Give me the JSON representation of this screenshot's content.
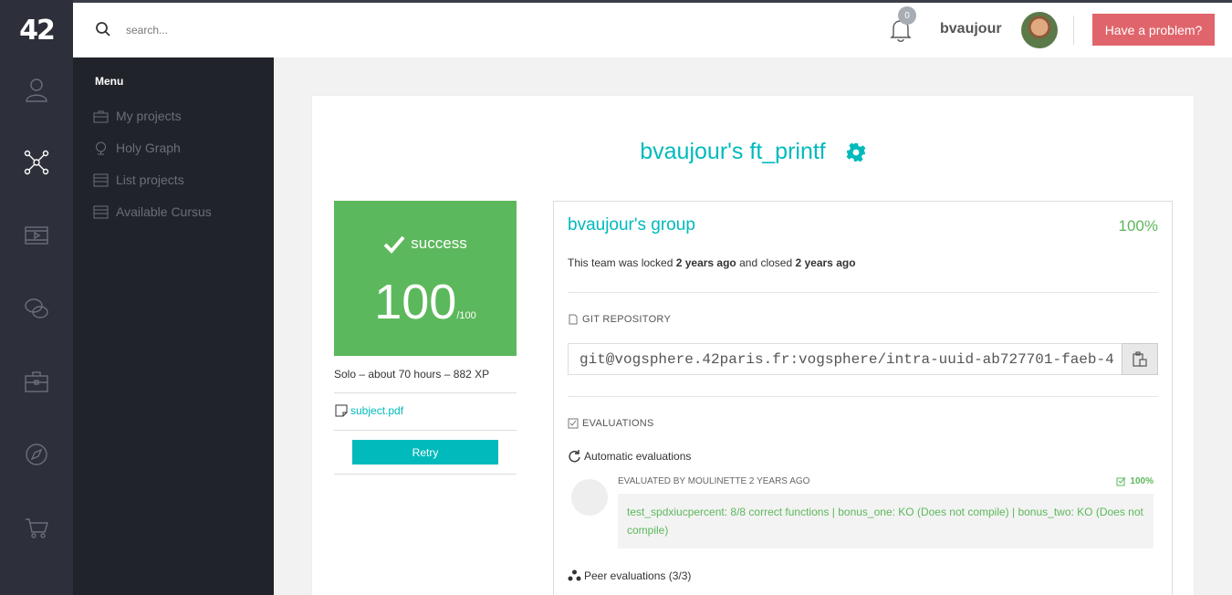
{
  "brand": {
    "logo": "42",
    "accent": "#00babc",
    "success": "#5cb85c",
    "danger": "#e0646b"
  },
  "rail": {
    "icons": [
      "user-icon",
      "holy-graph-icon",
      "video-icon",
      "chat-icon",
      "briefcase-icon",
      "compass-icon",
      "shop-icon"
    ]
  },
  "menu": {
    "title": "Menu",
    "items": [
      {
        "label": "My projects",
        "icon": "briefcase-icon"
      },
      {
        "label": "Holy Graph",
        "icon": "globe-icon"
      },
      {
        "label": "List projects",
        "icon": "list-icon"
      },
      {
        "label": "Available Cursus",
        "icon": "list-icon"
      }
    ]
  },
  "header": {
    "search_placeholder": "search...",
    "notifications": "0",
    "username": "bvaujour",
    "problem_button": "Have a problem?"
  },
  "project": {
    "title": "bvaujour's ft_printf",
    "status": "success",
    "score": "100",
    "score_max": "/100",
    "meta": "Solo – about 70 hours – 882 XP",
    "subject_link": "subject.pdf",
    "retry_button": "Retry"
  },
  "group": {
    "title": "bvaujour's group",
    "percent": "100%",
    "locked_prefix": "This team was locked ",
    "locked_time": "2 years ago",
    "closed_prefix": " and closed ",
    "closed_time": "2 years ago",
    "git_label": "GIT REPOSITORY",
    "git_url": "git@vogsphere.42paris.fr:vogsphere/intra-uuid-ab727701-faeb-4",
    "evaluations_label": "EVALUATIONS",
    "automatic_label": "Automatic evaluations",
    "evaluated_by": "EVALUATED BY MOULINETTE 2 YEARS AGO",
    "eval_percent": "100%",
    "eval_result": "test_spdxiucpercent: 8/8 correct functions | bonus_one: KO (Does not compile) | bonus_two: KO (Does not compile)",
    "peer_label": "Peer evaluations (3/3)"
  }
}
